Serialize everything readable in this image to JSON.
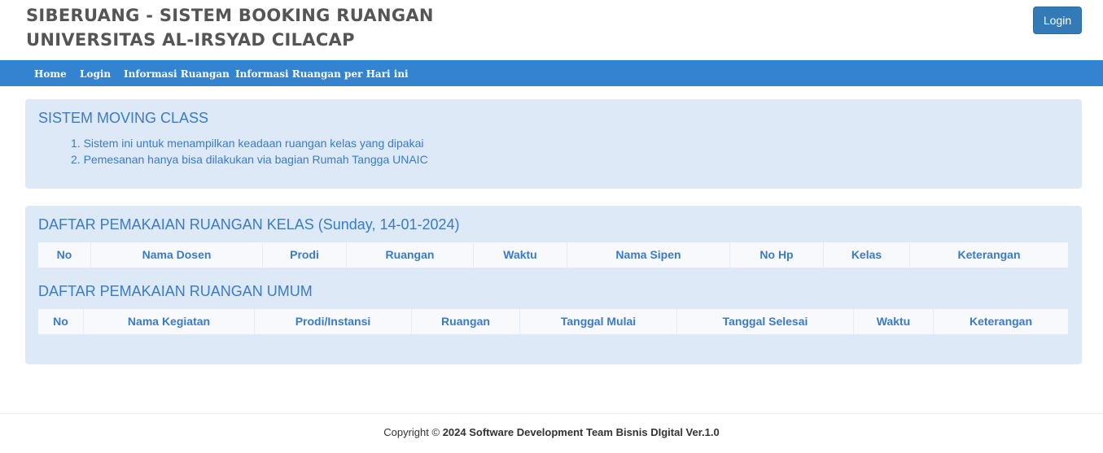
{
  "header": {
    "title_line1": "SIBERUANG - SISTEM BOOKING RUANGAN",
    "title_line2": "UNIVERSITAS AL-IRSYAD CILACAP",
    "login_button": "Login"
  },
  "nav": {
    "items": [
      "Home",
      "Login",
      "Informasi Ruangan",
      "Informasi Ruangan per Hari ini"
    ]
  },
  "info_panel": {
    "heading": "SISTEM MOVING CLASS",
    "items": [
      "1. Sistem ini untuk menampilkan keadaan ruangan kelas yang dipakai",
      "2. Pemesanan hanya bisa dilakukan via bagian Rumah Tangga UNAIC"
    ]
  },
  "class_usage": {
    "heading": "DAFTAR PEMAKAIAN RUANGAN KELAS (Sunday, 14-01-2024)",
    "columns": [
      "No",
      "Nama Dosen",
      "Prodi",
      "Ruangan",
      "Waktu",
      "Nama Sipen",
      "No Hp",
      "Kelas",
      "Keterangan"
    ]
  },
  "general_usage": {
    "heading": "DAFTAR PEMAKAIAN RUANGAN UMUM",
    "columns": [
      "No",
      "Nama Kegiatan",
      "Prodi/Instansi",
      "Ruangan",
      "Tanggal Mulai",
      "Tanggal Selesai",
      "Waktu",
      "Keterangan"
    ]
  },
  "footer": {
    "prefix": "Copyright ©",
    "text": "2024 Software Development Team Bisnis DIgital Ver.1.0"
  }
}
